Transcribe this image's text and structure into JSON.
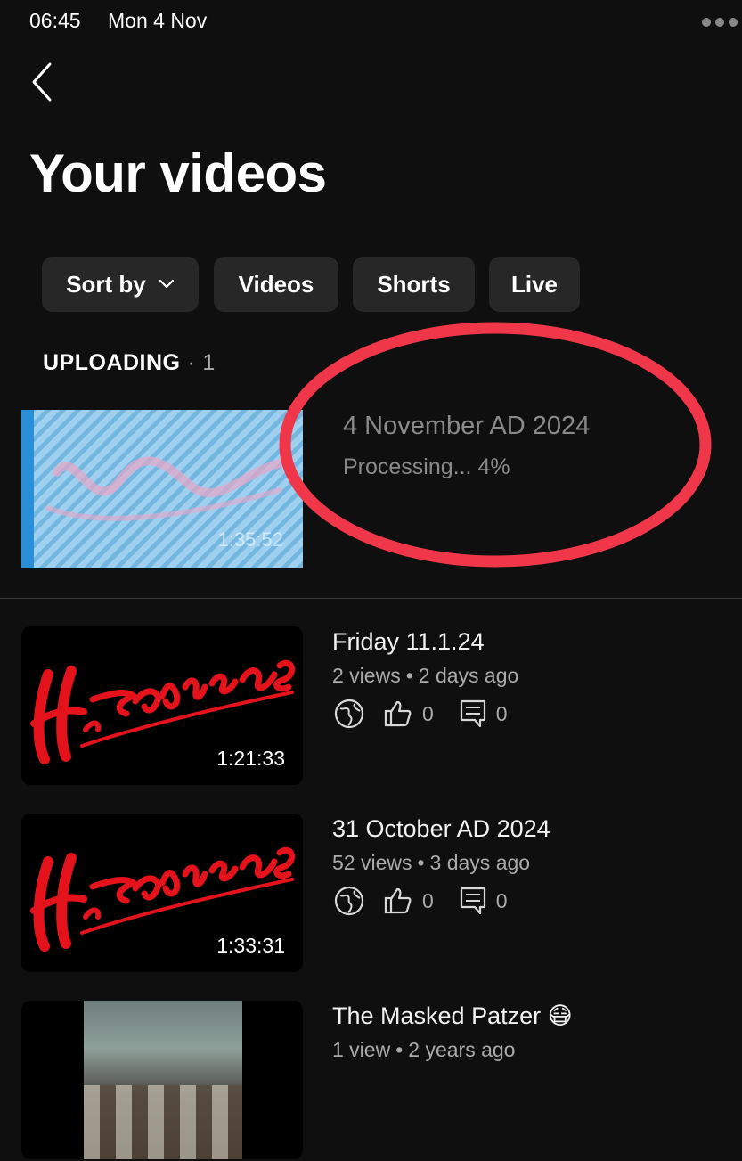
{
  "status_bar": {
    "time": "06:45",
    "date": "Mon 4 Nov"
  },
  "header": {
    "title": "Your videos"
  },
  "filters": {
    "sort_label": "Sort by",
    "chips": [
      "Videos",
      "Shorts",
      "Live"
    ]
  },
  "uploading": {
    "section_label": "UPLOADING",
    "separator": "·",
    "count": "1",
    "item": {
      "title": "4 November AD 2024",
      "status": "Processing... 4%",
      "progress_percent": 4,
      "duration": "1:35:52"
    }
  },
  "videos": [
    {
      "title": "Friday 11.1.24",
      "views": "2 views",
      "age": "2 days ago",
      "likes": "0",
      "comments": "0",
      "duration": "1:21:33",
      "visibility": "public-globe-icon"
    },
    {
      "title": "31 October AD 2024",
      "views": "52 views",
      "age": "3 days ago",
      "likes": "0",
      "comments": "0",
      "duration": "1:33:31",
      "visibility": "public-globe-icon"
    },
    {
      "title": "The Masked Patzer 😷",
      "views": "1 view",
      "age": "2 years ago"
    }
  ],
  "colors": {
    "background": "#0f0f0f",
    "chip": "#272727",
    "annotation": "#f0374a",
    "logo_red": "#e3121b"
  }
}
